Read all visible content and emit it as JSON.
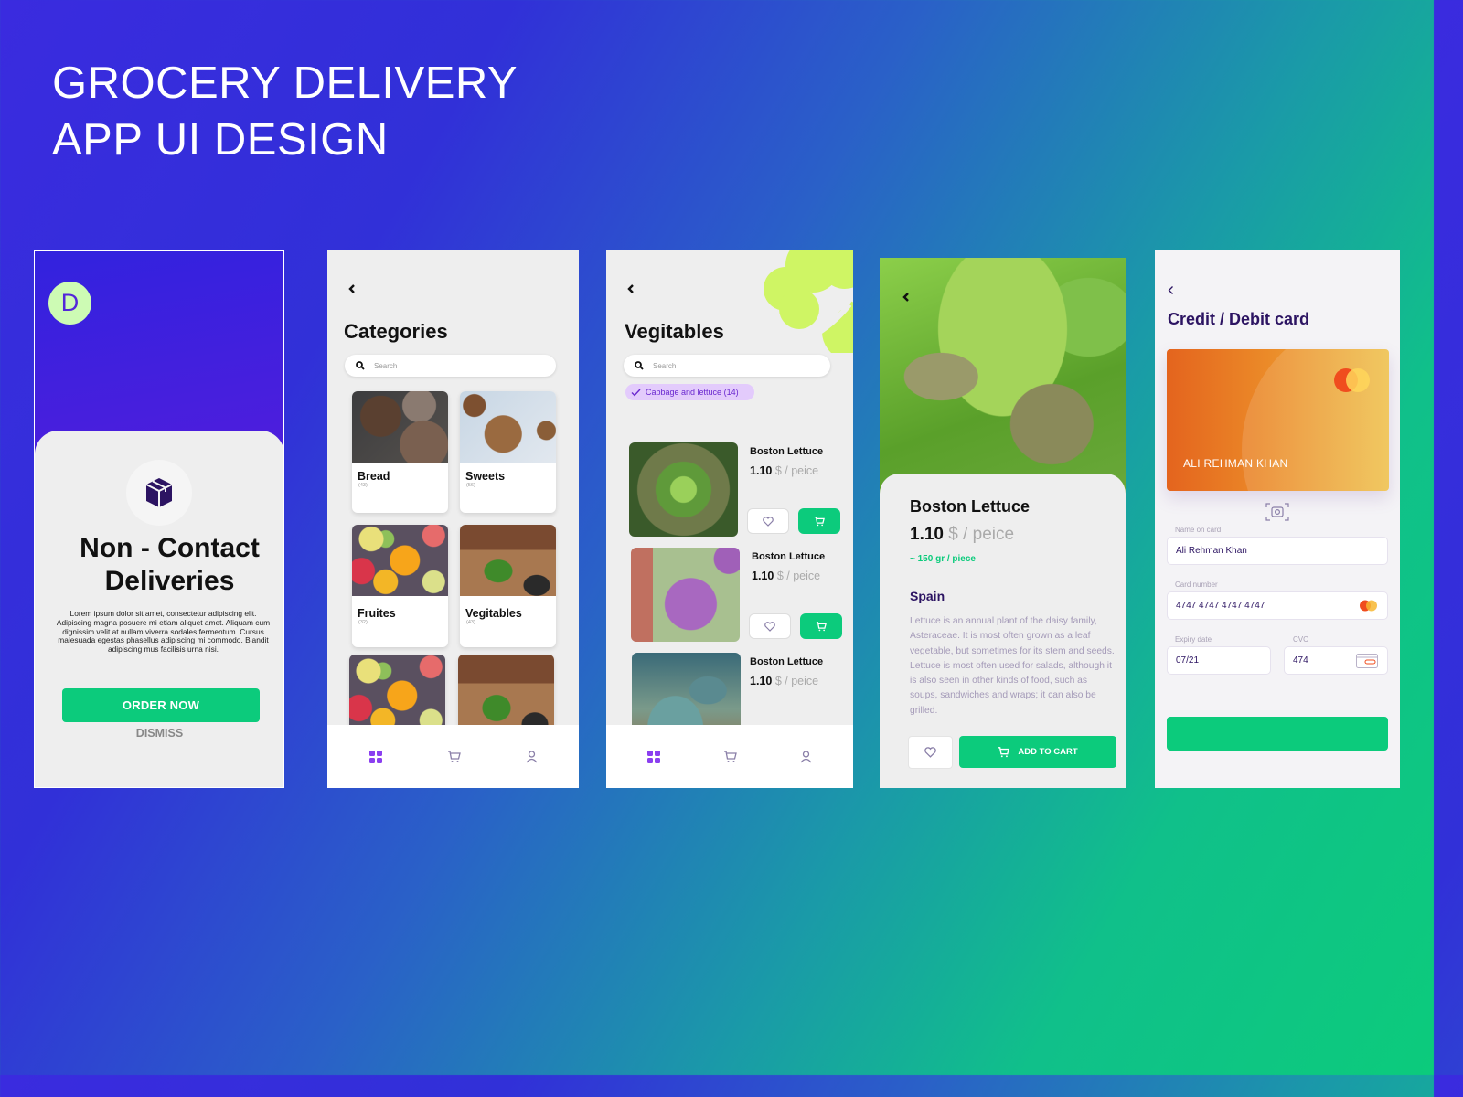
{
  "hero": {
    "line1": "GROCERY DELIVERY",
    "line2": "APP UI DESIGN"
  },
  "colors": {
    "accent_green": "#0ccb7c",
    "purple": "#6a28cf",
    "dark_purple": "#2c1462",
    "lime": "#cdfbb4"
  },
  "onboarding": {
    "avatar_letter": "D",
    "icon": "package-box-icon",
    "title_line1": "Non - Contact",
    "title_line2": "Deliveries",
    "body": "Lorem ipsum dolor sit amet, consectetur adipiscing elit. Adipiscing magna posuere mi etiam aliquet amet. Aliquam cum dignissim velit at nullam viverra sodales fermentum. Cursus malesuada egestas phasellus adipiscing mi commodo. Blandit adipiscing mus facilisis urna nisi.",
    "order_button": "ORDER NOW",
    "dismiss_button": "DISMISS"
  },
  "categories": {
    "title": "Categories",
    "search_placeholder": "Search",
    "items": [
      {
        "name": "Bread",
        "count": "(43)"
      },
      {
        "name": "Sweets",
        "count": "(56)"
      },
      {
        "name": "Fruites",
        "count": "(32)"
      },
      {
        "name": "Vegitables",
        "count": "(43)"
      }
    ],
    "nav": [
      "grid-icon",
      "cart-icon",
      "user-icon"
    ]
  },
  "vegetables": {
    "title": "Vegitables",
    "search_placeholder": "Search",
    "filter_chip": "Cabbage and lettuce (14)",
    "products": [
      {
        "name": "Boston Lettuce",
        "price": "1.10",
        "unit": "$ / peice"
      },
      {
        "name": "Boston Lettuce",
        "price": "1.10",
        "unit": "$ / peice"
      },
      {
        "name": "Boston Lettuce",
        "price": "1.10",
        "unit": "$ / peice"
      }
    ]
  },
  "detail": {
    "name": "Boston Lettuce",
    "price": "1.10",
    "unit": "$ / peice",
    "weight": "~ 150 gr / piece",
    "origin": "Spain",
    "description": "Lettuce is an annual plant of the daisy family, Asteraceae. It is most often grown as a leaf vegetable, but sometimes for its stem and seeds. Lettuce is most often used for salads, although it is also seen in other kinds of food, such as soups, sandwiches and wraps; it can also be grilled.",
    "add_to_cart": "ADD TO CART"
  },
  "payment": {
    "title": "Credit / Debit card",
    "card_holder": "ALI REHMAN KHAN",
    "name_label": "Name on card",
    "name_value": "Ali Rehman Khan",
    "number_label": "Card number",
    "number_value": "4747  4747  4747  4747",
    "expiry_label": "Expiry date",
    "expiry_value": "07/21",
    "cvc_label": "CVC",
    "cvc_value": "474"
  }
}
